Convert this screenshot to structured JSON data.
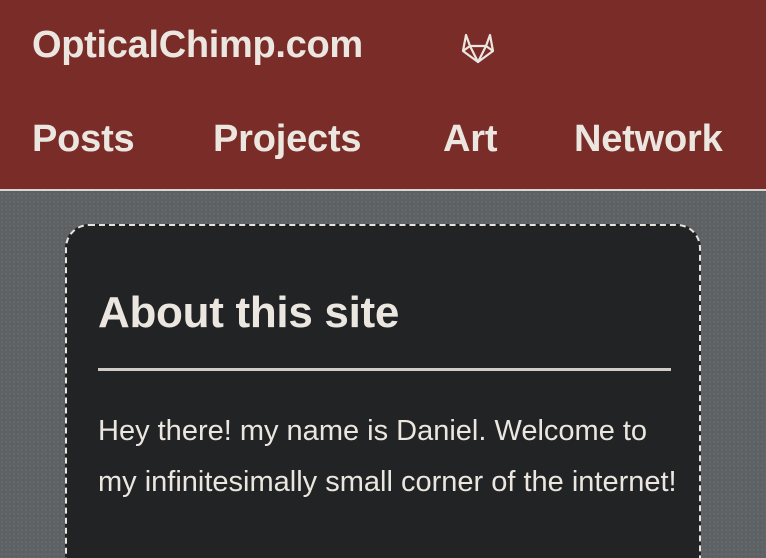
{
  "header": {
    "site_title": "OpticalChimp.com",
    "gitlab_icon": "gitlab-icon",
    "nav": [
      "Posts",
      "Projects",
      "Art",
      "Network"
    ]
  },
  "card": {
    "title": "About this site",
    "text": "Hey there! my name is Daniel. Welcome to my infinitesimally small corner of the internet!"
  },
  "colors": {
    "header_bg": "#7a2c28",
    "page_bg": "#5f6265",
    "card_bg": "#222324",
    "text": "#ebe7e0"
  }
}
